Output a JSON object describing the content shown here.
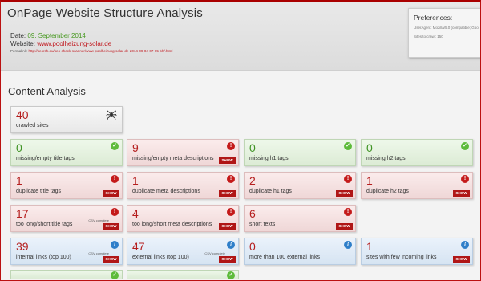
{
  "header": {
    "title": "OnPage Website Structure Analysis",
    "date_label": "Date:",
    "date_value": "09. September 2014",
    "website_label": "Website:",
    "website_value": "www.poolheizung-solar.de",
    "permalink_label": "Permalink:",
    "permalink_value": "http://seorch.eu/seo-check-scanner/www-poolheizung-solar-de-2014-09-04-07-05-bh/.html"
  },
  "preferences": {
    "title": "Preferences:",
    "useragent": "UserAgent: Mozilla/5.0 (compatible; Goo",
    "sites_to_crawl": "Sites to crawl: 150"
  },
  "content": {
    "section_title": "Content Analysis",
    "show_label": "SHOW",
    "csv_label": "CSV complete",
    "crawled": {
      "value": "40",
      "label": "crawled sites",
      "icon": "spider-icon"
    },
    "rows": [
      [
        {
          "value": "0",
          "label": "missing/empty title tags",
          "status": "ok",
          "show": false,
          "csv": false
        },
        {
          "value": "9",
          "label": "missing/empty meta descriptions",
          "status": "err",
          "show": true,
          "csv": false
        },
        {
          "value": "0",
          "label": "missing h1 tags",
          "status": "ok",
          "show": false,
          "csv": false
        },
        {
          "value": "0",
          "label": "missing h2 tags",
          "status": "ok",
          "show": false,
          "csv": false
        }
      ],
      [
        {
          "value": "1",
          "label": "duplicate title tags",
          "status": "err",
          "show": true,
          "csv": false
        },
        {
          "value": "1",
          "label": "duplicate meta descriptions",
          "status": "err",
          "show": true,
          "csv": false
        },
        {
          "value": "2",
          "label": "duplicate h1 tags",
          "status": "err",
          "show": true,
          "csv": false
        },
        {
          "value": "1",
          "label": "duplicate h2 tags",
          "status": "err",
          "show": true,
          "csv": false
        }
      ],
      [
        {
          "value": "17",
          "label": "too long/short title tags",
          "status": "err",
          "show": true,
          "csv": true
        },
        {
          "value": "4",
          "label": "too long/short meta descriptions",
          "status": "err",
          "show": true,
          "csv": false
        },
        {
          "value": "6",
          "label": "short texts",
          "status": "err",
          "show": true,
          "csv": false
        }
      ],
      [
        {
          "value": "39",
          "label": "internal links (top 100)",
          "status": "info",
          "show": true,
          "csv": true
        },
        {
          "value": "47",
          "label": "external links (top 100)",
          "status": "info",
          "show": true,
          "csv": true
        },
        {
          "value": "0",
          "label": "more than 100 external links",
          "status": "info",
          "show": false,
          "csv": false
        },
        {
          "value": "1",
          "label": "sites with few incoming links",
          "status": "info",
          "show": true,
          "csv": false
        }
      ]
    ]
  },
  "colors": {
    "accent_red": "#b01616",
    "ok_green": "#5dbb3a",
    "info_blue": "#2f7fc9"
  }
}
